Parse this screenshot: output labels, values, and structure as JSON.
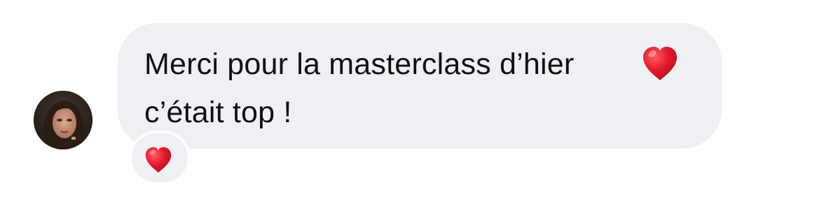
{
  "message": {
    "line1": "Merci pour la masterclass d’hier",
    "line2": "c’était top !",
    "inline_icon": "red-heart-emoji"
  },
  "reaction": {
    "icon": "red-heart-emoji"
  },
  "colors": {
    "bubble_background": "#eff0f4",
    "text": "#111111",
    "heart": "#e0182b",
    "page_background": "#ffffff"
  },
  "avatar": {
    "icon": "user-avatar"
  }
}
